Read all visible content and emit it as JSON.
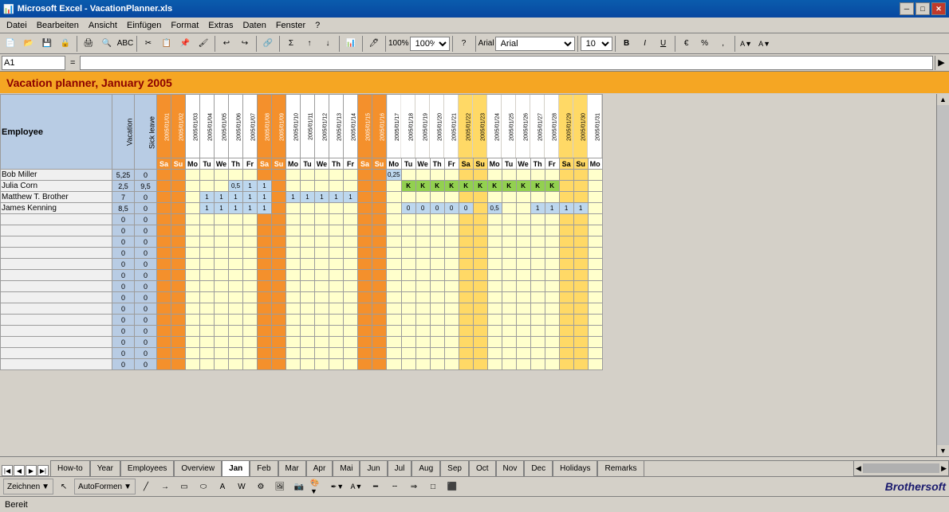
{
  "titleBar": {
    "appIcon": "📊",
    "title": "Microsoft Excel - VacationPlanner.xls",
    "minimizeLabel": "─",
    "maximizeLabel": "□",
    "closeLabel": "✕"
  },
  "menuBar": {
    "items": [
      "Datei",
      "Bearbeiten",
      "Ansicht",
      "Einfügen",
      "Format",
      "Extras",
      "Daten",
      "Fenster",
      "?"
    ]
  },
  "formulaBar": {
    "cellRef": "A1",
    "equalsSign": "="
  },
  "spreadsheet": {
    "title": "Vacation planner, January 2005",
    "headers": {
      "employee": "Employee",
      "vacation": "Vacation",
      "sickLeave": "Sick leave"
    },
    "dates": [
      {
        "date": "2005/01/01",
        "day": "Sa",
        "weekend": true,
        "orange": true
      },
      {
        "date": "2005/01/02",
        "day": "Su",
        "weekend": true,
        "orange": true
      },
      {
        "date": "2005/01/03",
        "day": "Mo",
        "weekend": false,
        "orange": false
      },
      {
        "date": "2005/01/04",
        "day": "Tu",
        "weekend": false,
        "orange": false
      },
      {
        "date": "2005/01/05",
        "day": "We",
        "weekend": false,
        "orange": false
      },
      {
        "date": "2005/01/06",
        "day": "Th",
        "weekend": false,
        "orange": false
      },
      {
        "date": "2005/01/07",
        "day": "Fr",
        "weekend": false,
        "orange": false
      },
      {
        "date": "2005/01/08",
        "day": "Sa",
        "weekend": true,
        "orange": true
      },
      {
        "date": "2005/01/09",
        "day": "Su",
        "weekend": true,
        "orange": true
      },
      {
        "date": "2005/01/10",
        "day": "Mo",
        "weekend": false,
        "orange": false
      },
      {
        "date": "2005/01/11",
        "day": "Tu",
        "weekend": false,
        "orange": false
      },
      {
        "date": "2005/01/12",
        "day": "We",
        "weekend": false,
        "orange": false
      },
      {
        "date": "2005/01/13",
        "day": "Th",
        "weekend": false,
        "orange": false
      },
      {
        "date": "2005/01/14",
        "day": "Fr",
        "weekend": false,
        "orange": false
      },
      {
        "date": "2005/01/15",
        "day": "Sa",
        "weekend": true,
        "orange": true
      },
      {
        "date": "2005/01/16",
        "day": "Su",
        "weekend": true,
        "orange": true
      },
      {
        "date": "2005/01/17",
        "day": "Mo",
        "weekend": false,
        "orange": false
      },
      {
        "date": "2005/01/18",
        "day": "Tu",
        "weekend": false,
        "orange": false
      },
      {
        "date": "2005/01/19",
        "day": "We",
        "weekend": false,
        "orange": false
      },
      {
        "date": "2005/01/20",
        "day": "Th",
        "weekend": false,
        "orange": false
      },
      {
        "date": "2005/01/21",
        "day": "Fr",
        "weekend": false,
        "orange": false
      },
      {
        "date": "2005/01/22",
        "day": "Sa",
        "weekend": true,
        "orange": false
      },
      {
        "date": "2005/01/23",
        "day": "Su",
        "weekend": true,
        "orange": false
      },
      {
        "date": "2005/01/24",
        "day": "Mo",
        "weekend": false,
        "orange": false
      },
      {
        "date": "2005/01/25",
        "day": "Tu",
        "weekend": false,
        "orange": false
      },
      {
        "date": "2005/01/26",
        "day": "We",
        "weekend": false,
        "orange": false
      },
      {
        "date": "2005/01/27",
        "day": "Th",
        "weekend": false,
        "orange": false
      },
      {
        "date": "2005/01/28",
        "day": "Fr",
        "weekend": false,
        "orange": false
      },
      {
        "date": "2005/01/29",
        "day": "Sa",
        "weekend": true,
        "orange": false
      },
      {
        "date": "2005/01/30",
        "day": "Su",
        "weekend": true,
        "orange": false
      },
      {
        "date": "2005/01/31",
        "day": "Mo",
        "weekend": false,
        "orange": false
      }
    ],
    "employees": [
      {
        "name": "Bob Miller",
        "vacation": "5,25",
        "sick": "0",
        "days": {
          "17": "0,25"
        }
      },
      {
        "name": "Julia Corn",
        "vacation": "2,5",
        "sick": "9,5",
        "days": {
          "6": "0,5",
          "7": "1",
          "8": "1",
          "18": "K",
          "19": "K",
          "20": "K",
          "21": "K",
          "22": "K",
          "23": "K",
          "24": "K",
          "25": "K",
          "26": "K",
          "27": "K",
          "28": "K"
        }
      },
      {
        "name": "Matthew T. Brother",
        "vacation": "7",
        "sick": "0",
        "days": {
          "4": "1",
          "5": "1",
          "6": "1",
          "7": "1",
          "8": "1",
          "10": "1",
          "11": "1",
          "12": "1",
          "13": "1",
          "14": "1"
        }
      },
      {
        "name": "James Kenning",
        "vacation": "8,5",
        "sick": "0",
        "days": {
          "4": "1",
          "5": "1",
          "6": "1",
          "7": "1",
          "8": "1",
          "18": "0",
          "19": "0",
          "20": "0",
          "21": "0",
          "22": "0",
          "24": "0,5",
          "27": "1",
          "28": "1",
          "29": "1",
          "30": "1"
        }
      }
    ],
    "emptyRows": 14
  },
  "tabs": {
    "items": [
      "How-to",
      "Year",
      "Employees",
      "Overview",
      "Jan",
      "Feb",
      "Mar",
      "Apr",
      "Mai",
      "Jun",
      "Jul",
      "Aug",
      "Sep",
      "Oct",
      "Nov",
      "Dec",
      "Holidays",
      "Remarks"
    ],
    "active": "Jan"
  },
  "statusBar": {
    "text": "Bereit"
  },
  "drawingBar": {
    "drawLabel": "Zeichnen",
    "autoShapesLabel": "AutoFormen"
  },
  "watermark": "Brothersoft"
}
